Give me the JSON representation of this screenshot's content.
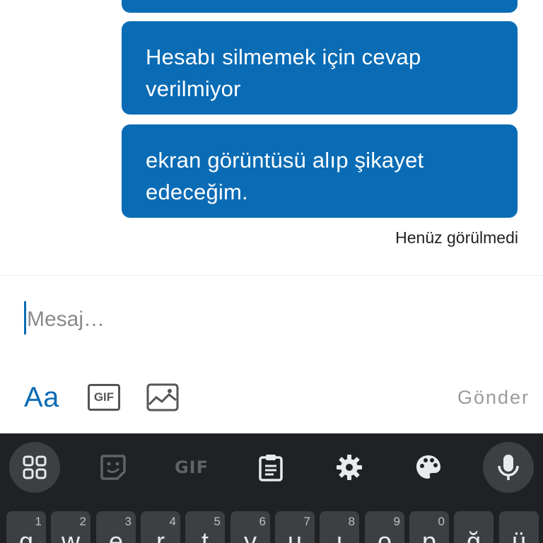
{
  "messages": [
    {
      "text": "Hesabı silmemek için cevap verilmiyor"
    },
    {
      "text": "ekran görüntüsü alıp şikayet edeceğim."
    }
  ],
  "message_status": "Henüz görülmedi",
  "composer": {
    "placeholder": "Mesaj…",
    "format_label": "Aa",
    "gif_label": "GIF",
    "send_label": "Gönder"
  },
  "keyboard": {
    "toolbar": {
      "gif_label": "GIF"
    },
    "row1": [
      {
        "letter": "q",
        "hint": "1"
      },
      {
        "letter": "w",
        "hint": "2"
      },
      {
        "letter": "e",
        "hint": "3"
      },
      {
        "letter": "r",
        "hint": "4"
      },
      {
        "letter": "t",
        "hint": "5"
      },
      {
        "letter": "y",
        "hint": "6"
      },
      {
        "letter": "u",
        "hint": "7"
      },
      {
        "letter": "ı",
        "hint": "8"
      },
      {
        "letter": "o",
        "hint": "9"
      },
      {
        "letter": "p",
        "hint": "0"
      },
      {
        "letter": "ğ",
        "hint": ""
      },
      {
        "letter": "ü",
        "hint": ""
      }
    ]
  },
  "colors": {
    "bubble": "#0a6cb5",
    "accent": "#0a6cb5",
    "keyboard_bg": "#202124",
    "key_bg": "#3c4043"
  }
}
